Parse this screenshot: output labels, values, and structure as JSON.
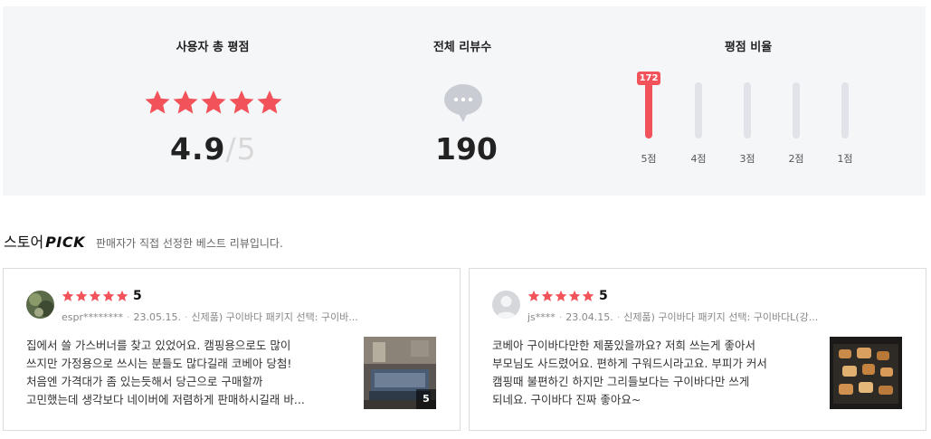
{
  "summary": {
    "user_score_title": "사용자 총 평점",
    "score": "4.9",
    "score_sep": "/",
    "score_max": "5",
    "stars": 5,
    "total_reviews_title": "전체 리뷰수",
    "total_reviews": "190",
    "ratio_title": "평점 비율",
    "ratio_bars": [
      {
        "label": "5점",
        "count": "172",
        "fraction": 1.0
      },
      {
        "label": "4점",
        "count": "",
        "fraction": 0
      },
      {
        "label": "3점",
        "count": "",
        "fraction": 0
      },
      {
        "label": "2점",
        "count": "",
        "fraction": 0
      },
      {
        "label": "1점",
        "count": "",
        "fraction": 0
      }
    ]
  },
  "pick": {
    "store": "스토어",
    "pick": "PICK",
    "desc": "판매자가 직접 선정한 베스트 리뷰입니다."
  },
  "reviews": [
    {
      "rating": "5",
      "stars": 5,
      "user": "espr********",
      "date": "23.05.15.",
      "option": "신제품) 구이바다 패키지 선택: 구이바...",
      "lines": [
        "집에서 쓸 가스버너를 찾고 있었어요. 캠핑용으로도 많이",
        "쓰지만 가정용으로 쓰시는 분들도 많다길래 코베아 당첨!",
        "처음엔 가격대가 좀 있는듯해서 당근으로 구매할까",
        "고민했는데 생각보다 네이버에 저렴하게 판매하시길래 바..."
      ],
      "photo_count": "5"
    },
    {
      "rating": "5",
      "stars": 5,
      "user": "js****",
      "date": "23.04.15.",
      "option": "신제품) 구이바다 패키지 선택: 구이바다L(강...",
      "lines": [
        "코베아 구이바다만한 제품있을까요? 저희 쓰는게 좋아서",
        "부모님도 사드렸어요. 편하게 구워드시라고요. 부피가 커서",
        "캠핑때 불편하긴 하지만 그리들보다는 구이바다만 쓰게",
        "되네요. 구이바다 진짜 좋아요~"
      ],
      "photo_count": ""
    }
  ],
  "colors": {
    "accent": "#f2535a",
    "panel": "#f5f6f8",
    "track": "#e1e3e8"
  }
}
